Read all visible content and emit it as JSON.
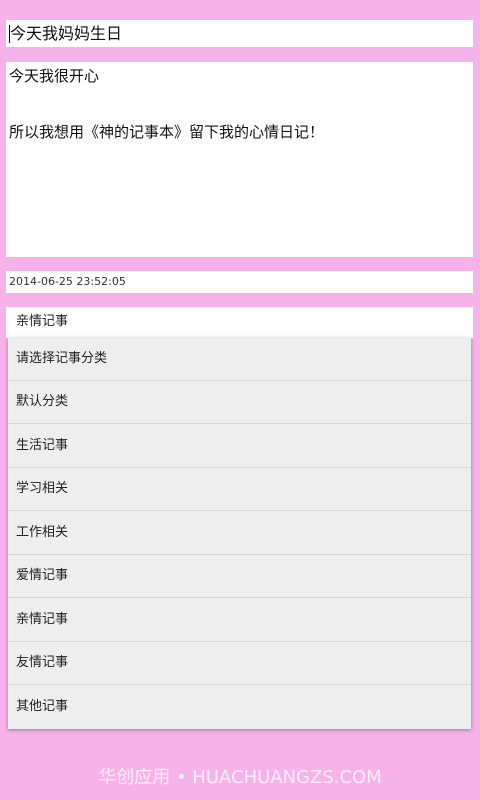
{
  "title_field": {
    "value": "今天我妈妈生日"
  },
  "content": {
    "line1": "今天我很开心",
    "line2": "所以我想用《神的记事本》留下我的心情日记！"
  },
  "datetime": "2014-06-25 23:52:05",
  "category": {
    "selected": "亲情记事",
    "options": [
      "请选择记事分类",
      "默认分类",
      "生活记事",
      "学习相关",
      "工作相关",
      "爱情记事",
      "亲情记事",
      "友情记事",
      "其他记事"
    ]
  },
  "watermark": "华创应用 • HUACHUANGZS.COM",
  "colors": {
    "background": "#f5b3e9",
    "field": "#ffffff",
    "dropdown": "#eeeeee"
  }
}
